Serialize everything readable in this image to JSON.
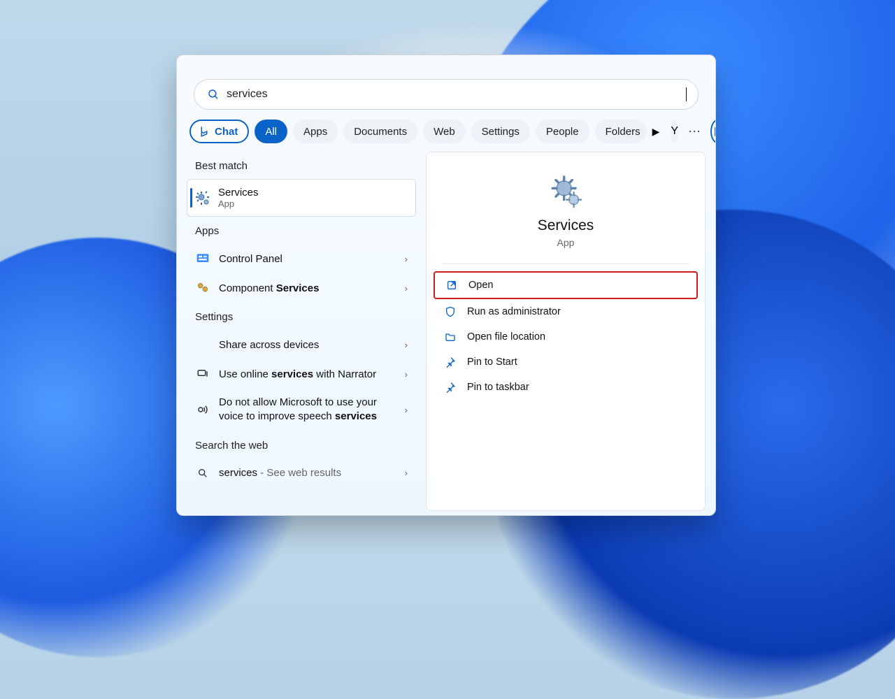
{
  "search": {
    "value": "services"
  },
  "filters": {
    "chat": "Chat",
    "items": [
      "All",
      "Apps",
      "Documents",
      "Web",
      "Settings",
      "People",
      "Folders"
    ],
    "active_index": 0,
    "avatar_letter": "Y"
  },
  "left": {
    "best_label": "Best match",
    "best": {
      "title": "Services",
      "subtitle": "App"
    },
    "apps_label": "Apps",
    "apps": [
      {
        "label": "Control Panel"
      },
      {
        "label_pre": "Component ",
        "label_bold": "Services"
      }
    ],
    "settings_label": "Settings",
    "settings": [
      {
        "label": "Share across devices"
      },
      {
        "label_pre": "Use online ",
        "label_bold": "services",
        "label_post": " with Narrator"
      },
      {
        "label_pre": "Do not allow Microsoft to use your voice to improve speech ",
        "label_bold": "services"
      }
    ],
    "web_label": "Search the web",
    "web": {
      "term": "services",
      "suffix": " - See web results"
    }
  },
  "detail": {
    "name": "Services",
    "type": "App",
    "actions": {
      "open": "Open",
      "admin": "Run as administrator",
      "loc": "Open file location",
      "pin_start": "Pin to Start",
      "pin_task": "Pin to taskbar"
    }
  }
}
